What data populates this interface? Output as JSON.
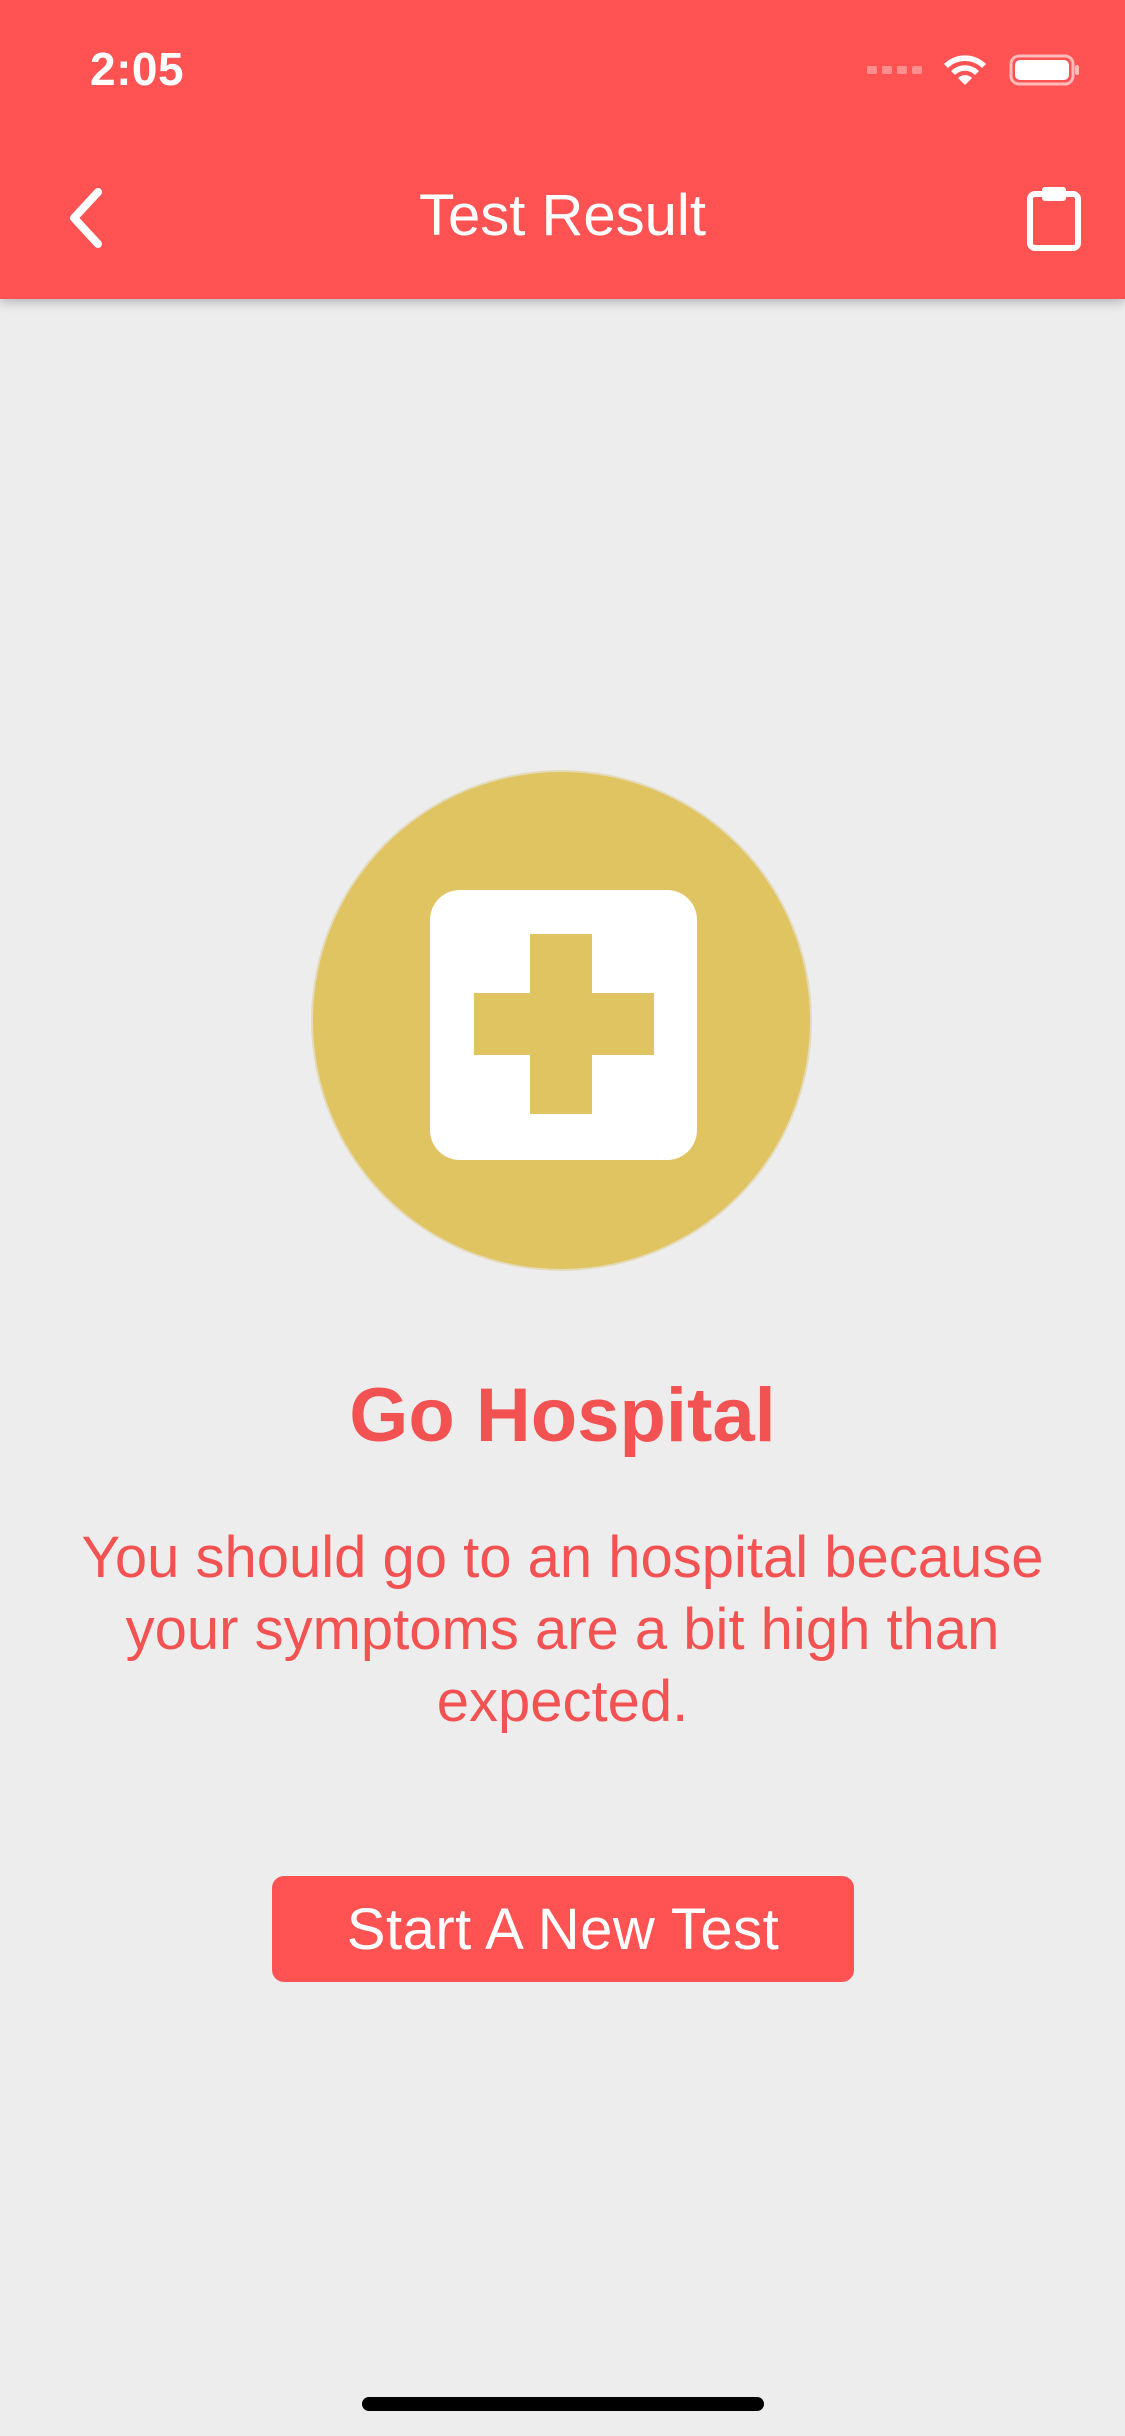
{
  "status_bar": {
    "time": "2:05"
  },
  "nav": {
    "title": "Test Result",
    "back_icon": "chevron-left-icon",
    "action_icon": "clipboard-icon"
  },
  "result": {
    "icon": "hospital-cross-icon",
    "title": "Go Hospital",
    "description": "You should go to an hospital because your symptoms are a bit high than expected."
  },
  "actions": {
    "new_test_label": "Start A New Test"
  },
  "colors": {
    "primary": "#FF5353",
    "text_accent": "#F25252",
    "circle": "#E1C462",
    "background": "#EEEDEE"
  }
}
